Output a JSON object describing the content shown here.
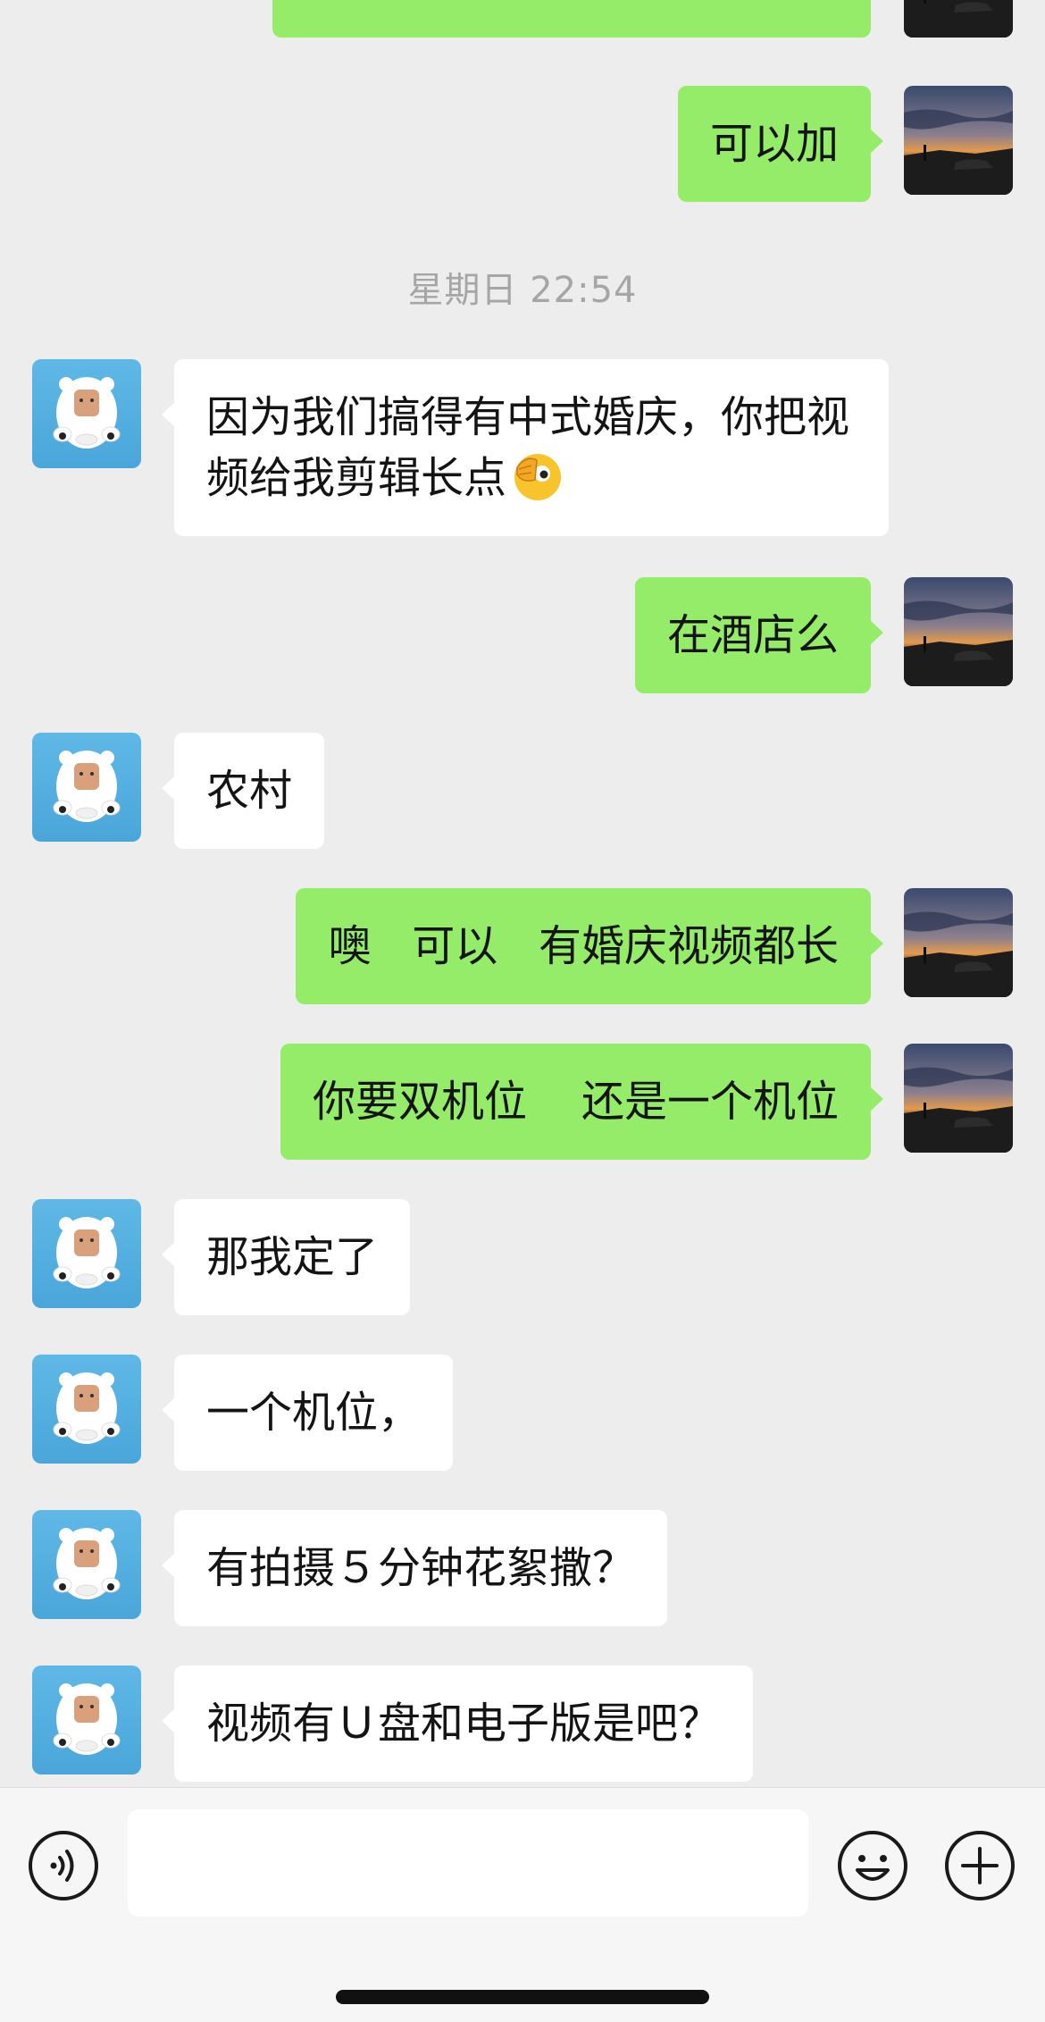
{
  "timestamp": "星期日 22:54",
  "messages": [
    {
      "side": "right",
      "text": "",
      "partial": true
    },
    {
      "side": "right",
      "text": "可以加"
    },
    {
      "side": "left",
      "text": "因为我们搞得有中式婚庆，你把视频给我剪辑长点",
      "emoji": "face-peeking-emoji"
    },
    {
      "side": "right",
      "text": "在酒店么"
    },
    {
      "side": "left",
      "text": "农村"
    },
    {
      "side": "right",
      "text": "噢   可以   有婚庆视频都长"
    },
    {
      "side": "right",
      "text": "你要双机位    还是一个机位"
    },
    {
      "side": "left",
      "text": "那我定了"
    },
    {
      "side": "left",
      "text": "一个机位，"
    },
    {
      "side": "left",
      "text": "有拍摄５分钟花絮撒？"
    },
    {
      "side": "left",
      "text": "视频有Ｕ盘和电子版是吧？"
    }
  ],
  "input": {
    "value": ""
  },
  "icons": {
    "voice": "voice-icon",
    "emoji": "emoji-icon",
    "more": "plus-icon"
  },
  "colors": {
    "background": "#ededed",
    "sent_bubble": "#95ec69",
    "received_bubble": "#ffffff"
  }
}
